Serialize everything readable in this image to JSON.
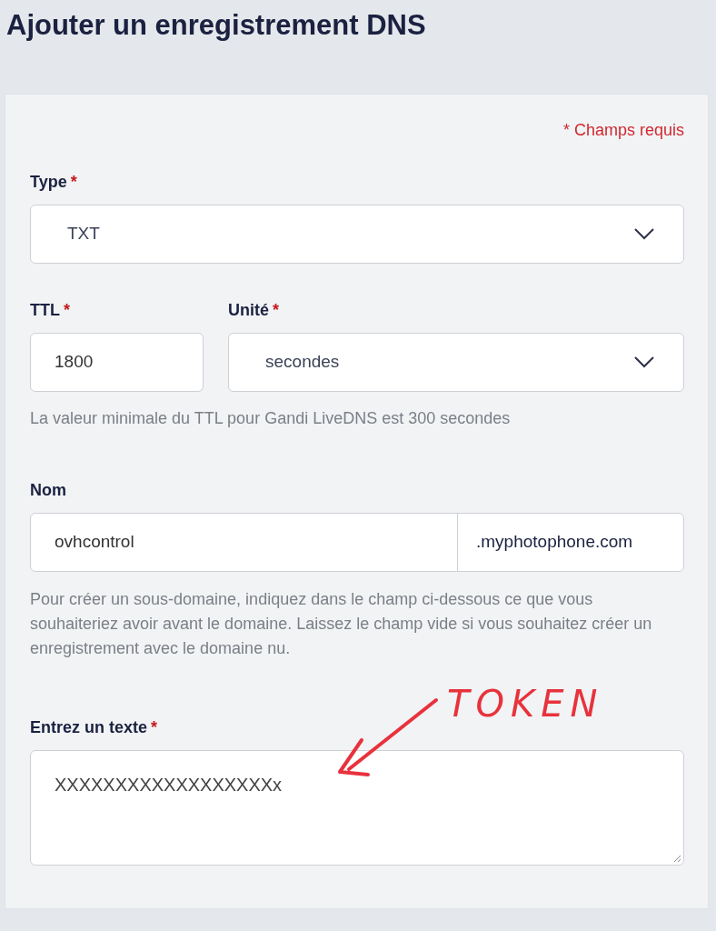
{
  "title": "Ajouter un enregistrement DNS",
  "required_note": "* Champs requis",
  "type": {
    "label": "Type",
    "required_mark": "*",
    "value": "TXT"
  },
  "ttl": {
    "label": "TTL",
    "required_mark": "*",
    "value": "1800"
  },
  "unit": {
    "label": "Unité",
    "required_mark": "*",
    "value": "secondes"
  },
  "ttl_hint": "La valeur minimale du TTL pour Gandi LiveDNS est 300 secondes",
  "name": {
    "label": "Nom",
    "value": "ovhcontrol",
    "suffix": ".myphotophone.com"
  },
  "name_hint": "Pour créer un sous-domaine, indiquez dans le champ ci-dessous ce que vous souhaiteriez avoir avant le domaine. Laissez le champ vide si vous souhaitez créer un enregistrement avec le domaine nu.",
  "text": {
    "label": "Entrez un texte",
    "required_mark": "*",
    "value": "XXXXXXXXXXXXXXXXXXx"
  },
  "annotation": {
    "text": "TOKEN"
  }
}
